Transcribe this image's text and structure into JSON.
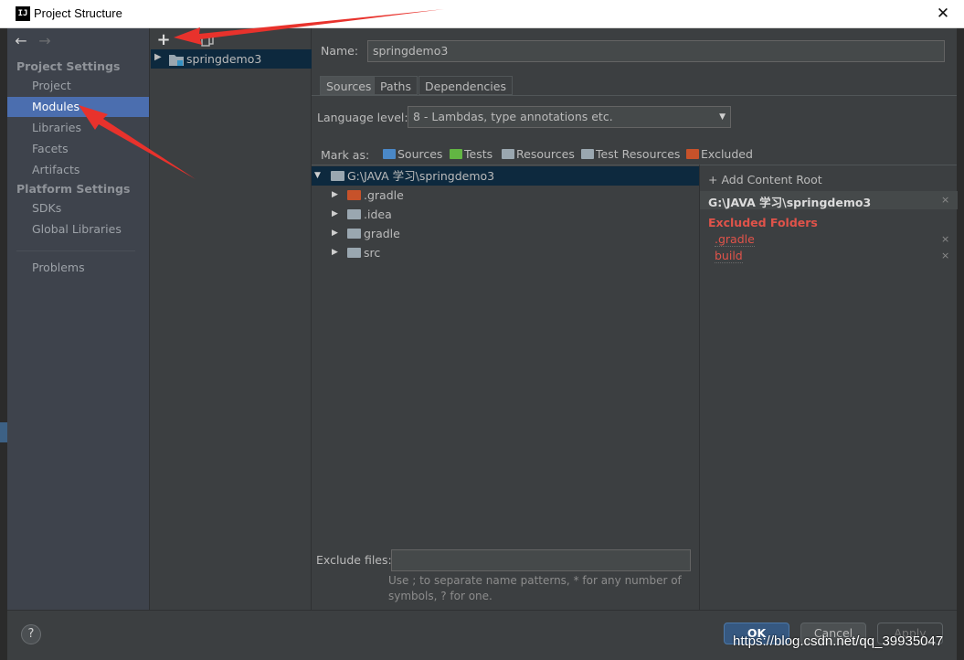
{
  "window": {
    "title": "Project Structure",
    "app_icon_text": "IJ",
    "close_symbol": "✕"
  },
  "sidebar": {
    "project_settings_header": "Project Settings",
    "platform_settings_header": "Platform Settings",
    "items": [
      {
        "label": "Project"
      },
      {
        "label": "Modules"
      },
      {
        "label": "Libraries"
      },
      {
        "label": "Facets"
      },
      {
        "label": "Artifacts"
      },
      {
        "label": "SDKs"
      },
      {
        "label": "Global Libraries"
      },
      {
        "label": "Problems"
      }
    ],
    "selected": "Modules"
  },
  "modules": {
    "add_symbol": "+",
    "items": [
      {
        "label": "springdemo3"
      }
    ]
  },
  "module_settings": {
    "name_label": "Name:",
    "name_value": "springdemo3",
    "tabs": [
      {
        "label": "Sources"
      },
      {
        "label": "Paths"
      },
      {
        "label": "Dependencies"
      }
    ],
    "active_tab": "Sources",
    "language_level_label": "Language level:",
    "language_level_value": "8 - Lambdas, type annotations etc.",
    "mark_as_label": "Mark as:",
    "mark_as": [
      {
        "label": "Sources",
        "color": "#4a88c7"
      },
      {
        "label": "Tests",
        "color": "#62b543"
      },
      {
        "label": "Resources",
        "color": "#9aa7b0"
      },
      {
        "label": "Test Resources",
        "color": "#9aa7b0"
      },
      {
        "label": "Excluded",
        "color": "#c7522a"
      }
    ],
    "tree": [
      {
        "label": "G:\\JAVA 学习\\springdemo3",
        "expanded": true,
        "color": "#9aa7b0"
      },
      {
        "label": ".gradle",
        "expanded": false,
        "color": "#c7522a"
      },
      {
        "label": ".idea",
        "expanded": false,
        "color": "#9aa7b0"
      },
      {
        "label": "gradle",
        "expanded": false,
        "color": "#9aa7b0"
      },
      {
        "label": "src",
        "expanded": false,
        "color": "#9aa7b0"
      }
    ],
    "exclude_files_label": "Exclude files:",
    "exclude_files_value": "",
    "exclude_hint_1": "Use ; to separate name patterns, * for any number of",
    "exclude_hint_2": "symbols, ? for one."
  },
  "content_root": {
    "add_label": "+ Add Content Root",
    "path": "G:\\JAVA 学习\\springdemo3",
    "excluded_header": "Excluded Folders",
    "excluded": [
      {
        "label": ".gradle"
      },
      {
        "label": "build"
      }
    ],
    "remove_symbol": "×"
  },
  "buttons": {
    "help": "?",
    "ok": "OK",
    "cancel": "Cancel",
    "apply": "Apply"
  },
  "watermark": "https://blog.csdn.net/qq_39935047",
  "colors": {
    "annotation_arrow": "#e8322c",
    "selection": "#4b6eaf",
    "excluded": "#e0534a"
  }
}
